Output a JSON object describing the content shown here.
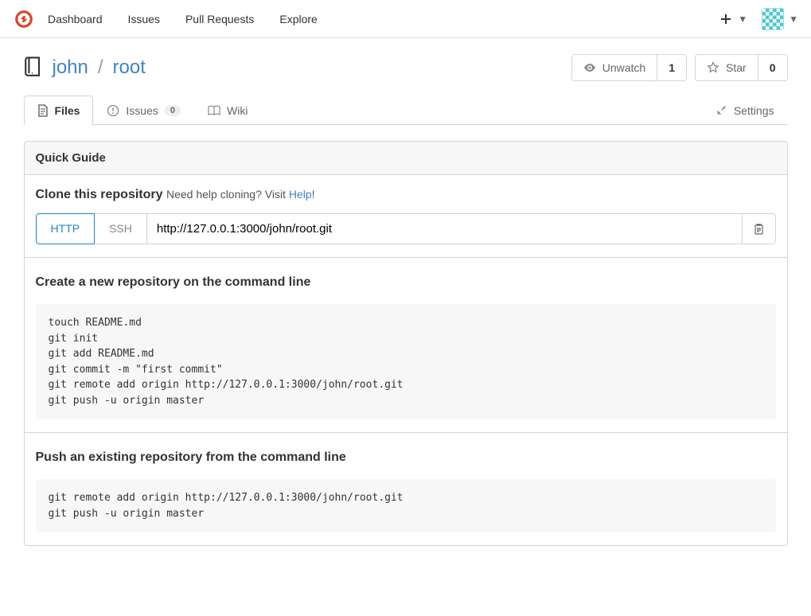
{
  "nav": {
    "dashboard": "Dashboard",
    "issues": "Issues",
    "pulls": "Pull Requests",
    "explore": "Explore"
  },
  "repo": {
    "owner": "john",
    "name": "root",
    "sep": "/"
  },
  "actions": {
    "unwatch_label": "Unwatch",
    "unwatch_count": "1",
    "star_label": "Star",
    "star_count": "0"
  },
  "tabs": {
    "files": "Files",
    "issues": "Issues",
    "issues_count": "0",
    "wiki": "Wiki",
    "settings": "Settings"
  },
  "guide": {
    "title": "Quick Guide",
    "clone_heading": "Clone this repository",
    "need_help": "Need help cloning? Visit ",
    "help_link": "Help",
    "exclaim": "!",
    "http_tab": "HTTP",
    "ssh_tab": "SSH",
    "clone_url": "http://127.0.0.1:3000/john/root.git",
    "create_heading": "Create a new repository on the command line",
    "create_code": "touch README.md\ngit init\ngit add README.md\ngit commit -m \"first commit\"\ngit remote add origin http://127.0.0.1:3000/john/root.git\ngit push -u origin master",
    "push_heading": "Push an existing repository from the command line",
    "push_code": "git remote add origin http://127.0.0.1:3000/john/root.git\ngit push -u origin master"
  }
}
